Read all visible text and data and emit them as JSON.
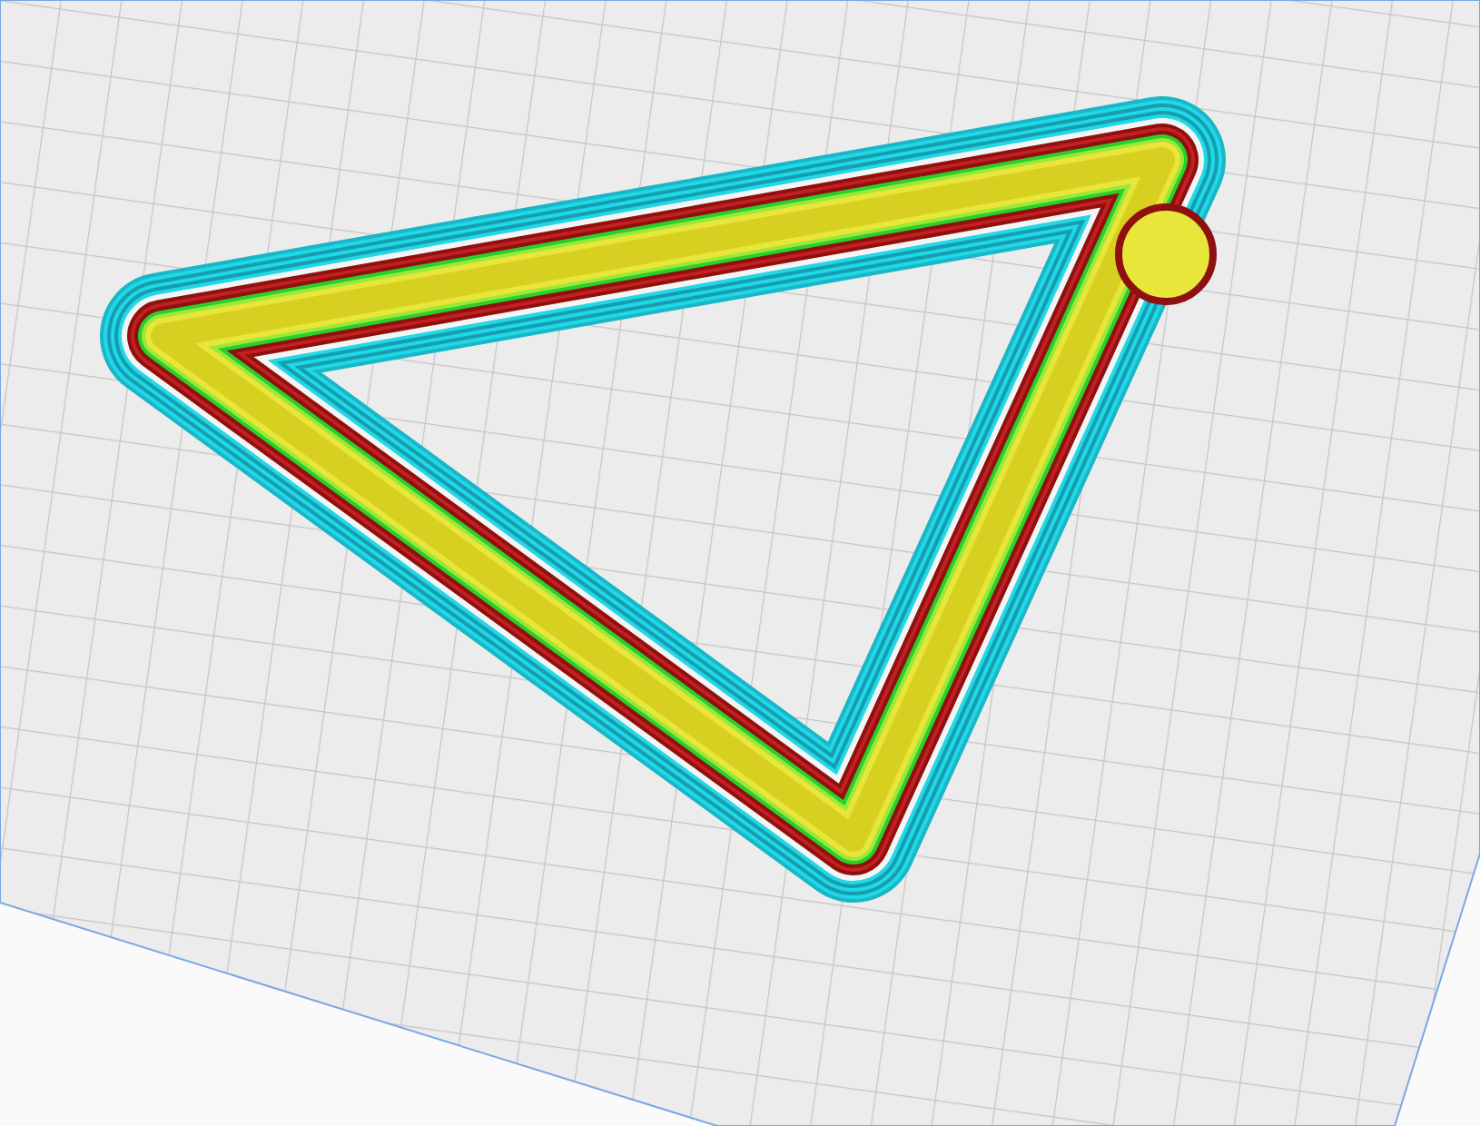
{
  "viewport": {
    "kind": "layer-preview"
  }
}
